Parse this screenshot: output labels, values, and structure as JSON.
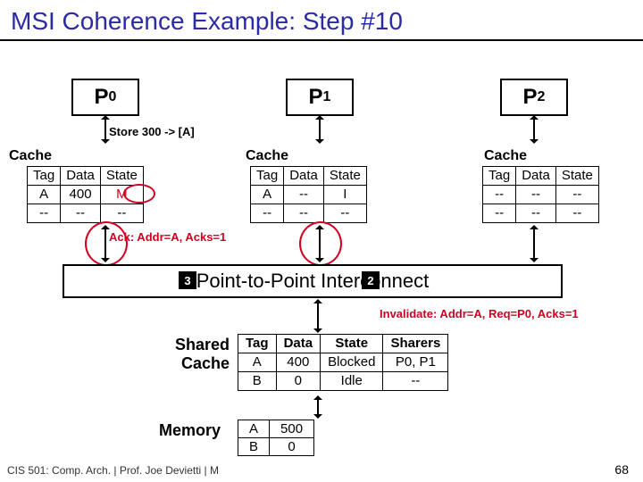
{
  "title": "MSI Coherence Example: Step #10",
  "processors": {
    "p0": "P0",
    "p1": "P1",
    "p2": "P2"
  },
  "store_action": "Store 300 -> [A]",
  "ack_action": "Ack: Addr=A, Acks=1",
  "invalidate_action": "Invalidate: Addr=A, Req=P0, Acks=1",
  "interconnect_label": "Point-to-Point Interconnect",
  "cache_word": "Cache",
  "shared_cache_label": "Shared\nCache",
  "memory_label": "Memory",
  "step_numbers": {
    "left": "3",
    "right": "2"
  },
  "headers": {
    "tag": "Tag",
    "data": "Data",
    "state": "State",
    "sharers": "Sharers"
  },
  "cache0": {
    "rows": [
      {
        "tag": "A",
        "data": "400",
        "state": "M"
      },
      {
        "tag": "--",
        "data": "--",
        "state": "--"
      }
    ]
  },
  "cache1": {
    "rows": [
      {
        "tag": "A",
        "data": "--",
        "state": "I"
      },
      {
        "tag": "--",
        "data": "--",
        "state": "--"
      }
    ]
  },
  "cache2": {
    "rows": [
      {
        "tag": "--",
        "data": "--",
        "state": "--"
      },
      {
        "tag": "--",
        "data": "--",
        "state": "--"
      }
    ]
  },
  "shared": {
    "rows": [
      {
        "tag": "A",
        "data": "400",
        "state": "Blocked",
        "sharers": "P0, P1"
      },
      {
        "tag": "B",
        "data": "0",
        "state": "Idle",
        "sharers": "--"
      }
    ]
  },
  "memory": {
    "rows": [
      {
        "tag": "A",
        "data": "500"
      },
      {
        "tag": "B",
        "data": "0"
      }
    ]
  },
  "footer": "CIS 501: Comp. Arch.  |  Prof. Joe Devietti  |  M",
  "page": "68"
}
